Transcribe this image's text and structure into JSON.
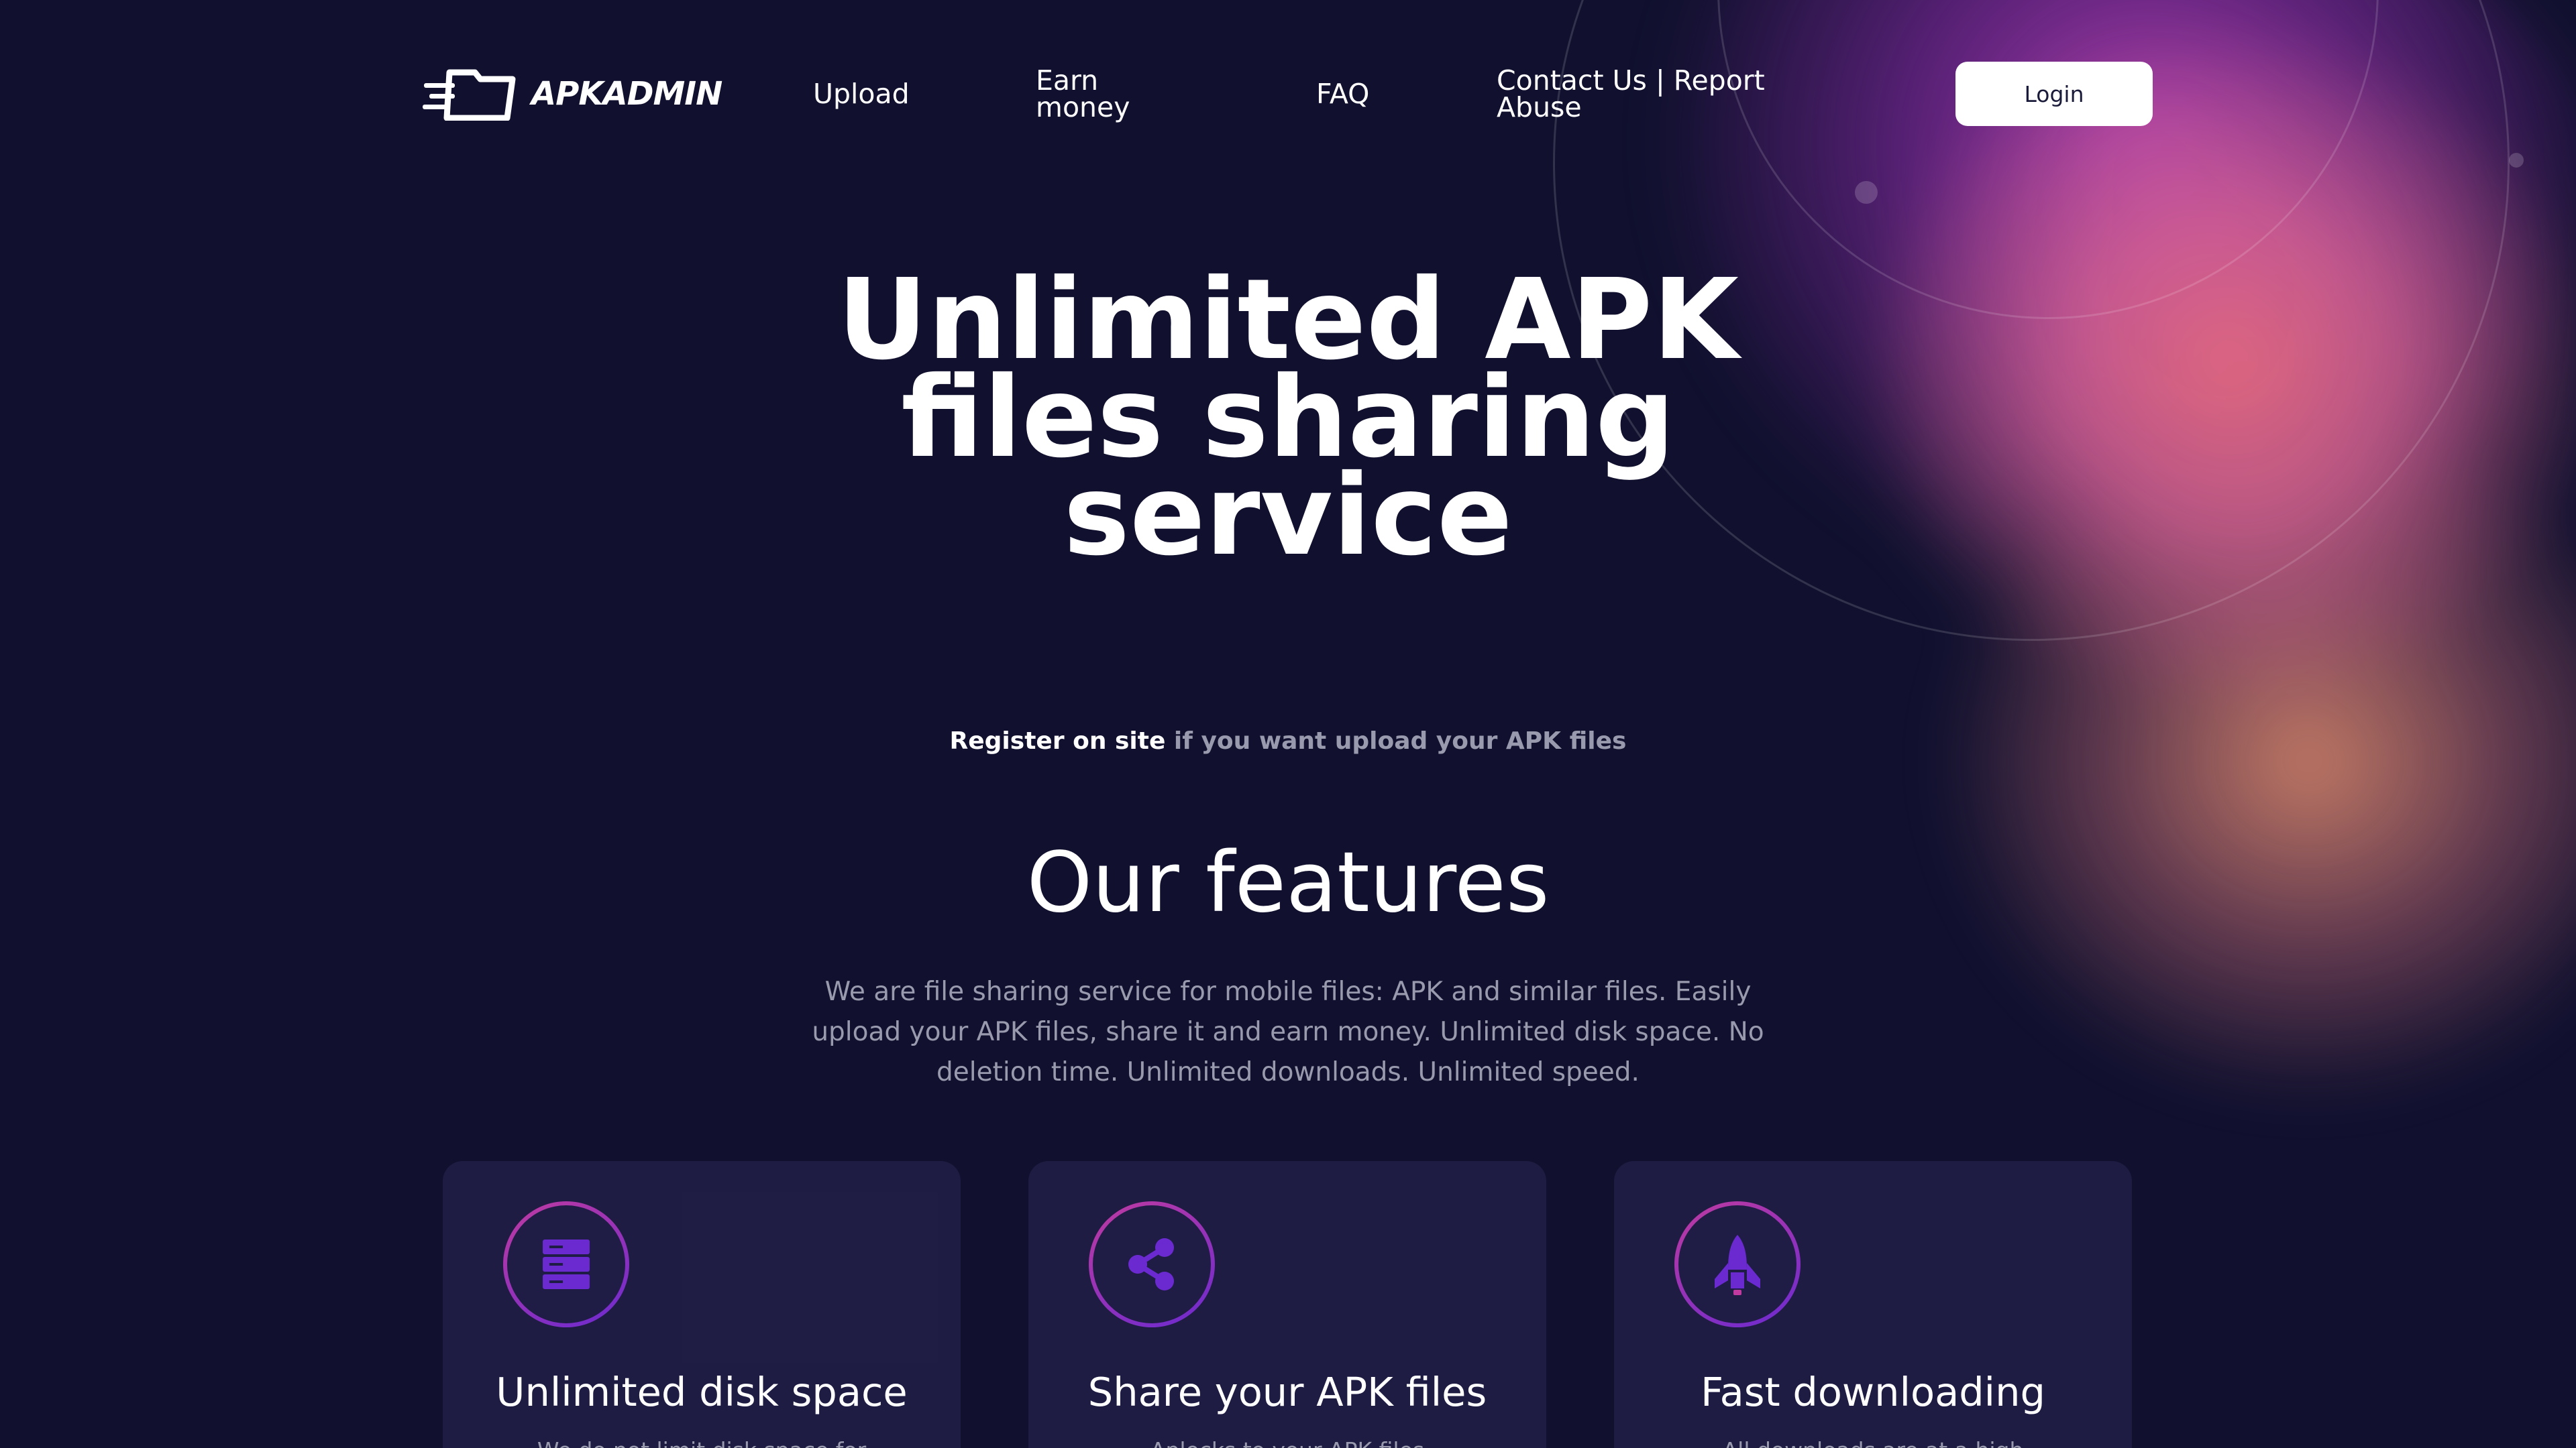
{
  "header": {
    "logo_text": "APKADMIN",
    "nav": {
      "upload": "Upload",
      "earn_money": "Earn money",
      "faq": "FAQ",
      "contact": "Contact Us | Report Abuse"
    },
    "login_label": "Login"
  },
  "hero": {
    "title": "Unlimited APK files sharing service",
    "register_link": "Register on site",
    "register_text": " if you want upload your APK files"
  },
  "features": {
    "title": "Our features",
    "description": "We are file sharing service for mobile files: APK and similar files. Easily upload your APK files, share it and earn money. Unlimited disk space. No deletion time. Unlimited downloads. Unlimited speed.",
    "cards": [
      {
        "icon": "server-icon",
        "title": "Unlimited disk space",
        "text": "We do not limit disk space for"
      },
      {
        "icon": "share-icon",
        "title": "Share your APK files",
        "text": "Aplocks to your APK files"
      },
      {
        "icon": "rocket-icon",
        "title": "Fast downloading",
        "text": "All downloads are at a high"
      }
    ]
  },
  "colors": {
    "background": "#11112f",
    "card": "#24204a",
    "icon_gradient_start": "#c03aa0",
    "icon_gradient_end": "#6a2ad0",
    "muted_text": "#9a9aae"
  }
}
